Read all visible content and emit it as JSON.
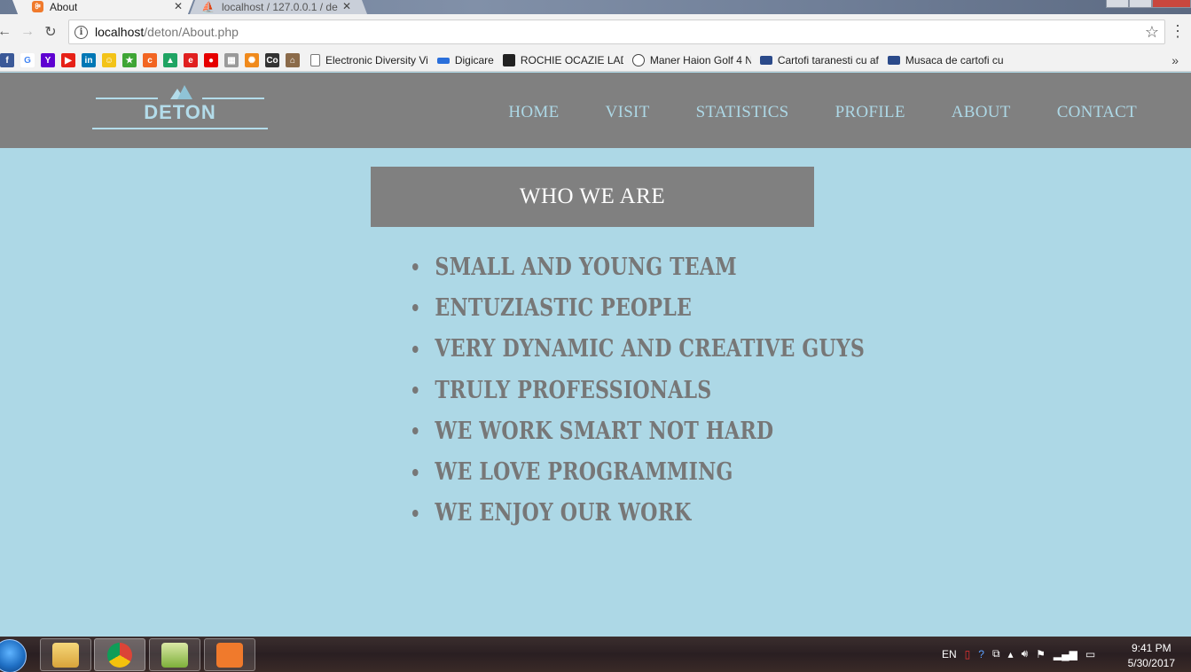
{
  "browser": {
    "tabs": [
      {
        "title": "About",
        "active": true
      },
      {
        "title": "localhost / 127.0.0.1 / de",
        "active": false
      }
    ],
    "url": {
      "host": "localhost",
      "path": "/deton/About.php"
    },
    "bookmarks": [
      {
        "label": "Electronic Diversity Vi",
        "icon_color": "#ffffff"
      },
      {
        "label": "Digicare",
        "icon_color": "#2a6fdb"
      },
      {
        "label": "ROCHIE OCAZIE LADY",
        "icon_color": "#222222"
      },
      {
        "label": "Maner Haion Golf 4 N",
        "icon_color": "#3f3f3f"
      },
      {
        "label": "Cartofi taranesti cu af",
        "icon_color": "#2b4a8a"
      },
      {
        "label": "Musaca de cartofi cu",
        "icon_color": "#2b4a8a"
      }
    ],
    "bookmark_icons": [
      {
        "name": "facebook-icon",
        "glyph": "f",
        "color": "#3b5998"
      },
      {
        "name": "google-icon",
        "glyph": "G",
        "color": "#ffffff"
      },
      {
        "name": "yahoo-icon",
        "glyph": "Y",
        "color": "#5f01d1"
      },
      {
        "name": "youtube-icon",
        "glyph": "▶",
        "color": "#e62117"
      },
      {
        "name": "linkedin-icon",
        "glyph": "in",
        "color": "#0077b5"
      },
      {
        "name": "smiley-icon",
        "glyph": "☺",
        "color": "#f3c318"
      },
      {
        "name": "star-green-icon",
        "glyph": "★",
        "color": "#3fa535"
      },
      {
        "name": "orange-c-icon",
        "glyph": "c",
        "color": "#f26522"
      },
      {
        "name": "drive-icon",
        "glyph": "▲",
        "color": "#1fa463"
      },
      {
        "name": "e-icon",
        "glyph": "e",
        "color": "#e02020"
      },
      {
        "name": "vodafone-icon",
        "glyph": "●",
        "color": "#e60000"
      },
      {
        "name": "grid-icon",
        "glyph": "▦",
        "color": "#9a9a9a"
      },
      {
        "name": "sun-icon",
        "glyph": "✺",
        "color": "#f08a1c"
      },
      {
        "name": "co-icon",
        "glyph": "Co",
        "color": "#333333"
      },
      {
        "name": "house-icon",
        "glyph": "⌂",
        "color": "#8b6b4a"
      }
    ]
  },
  "site": {
    "logo_text": "DETON",
    "nav": [
      "HOME",
      "VISIT",
      "STATISTICS",
      "PROFILE",
      "ABOUT",
      "CONTACT"
    ],
    "section_title": "WHO WE ARE",
    "traits": [
      "SMALL AND YOUNG TEAM",
      "ENTUZIASTIC PEOPLE",
      "VERY DYNAMIC AND CREATIVE GUYS",
      "TRULY PROFESSIONALS",
      "WE WORK SMART NOT HARD",
      "WE LOVE PROGRAMMING",
      "WE ENJOY OUR WORK"
    ]
  },
  "taskbar": {
    "language": "EN",
    "time": "9:41 PM",
    "date": "5/30/2017"
  },
  "colors": {
    "page_bg": "#add8e6",
    "header_bg": "#808080",
    "accent": "#add8e6"
  }
}
